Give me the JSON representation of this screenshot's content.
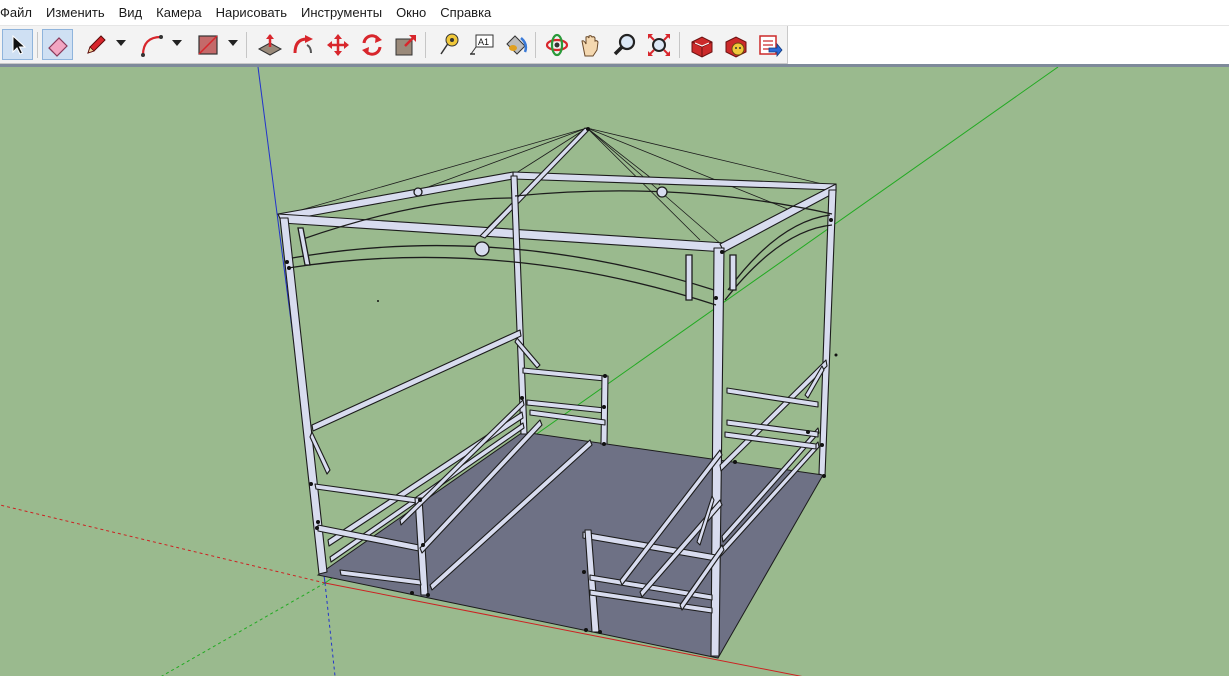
{
  "menu": [
    "Файл",
    "Изменить",
    "Вид",
    "Камера",
    "Нарисовать",
    "Инструменты",
    "Окно",
    "Справка"
  ],
  "toolbar": {
    "tools": [
      {
        "name": "select-tool",
        "icon": "arrow-cursor-icon",
        "active": true
      },
      {
        "name": "eraser-tool",
        "icon": "eraser-icon",
        "active": true
      },
      {
        "name": "pencil-tool",
        "icon": "pencil-icon"
      },
      {
        "name": "arc-tool",
        "icon": "arc-icon"
      },
      {
        "name": "rectangle-tool",
        "icon": "rectangle-icon"
      },
      {
        "name": "push-pull-tool",
        "icon": "push-pull-icon"
      },
      {
        "name": "follow-me-tool",
        "icon": "follow-me-icon"
      },
      {
        "name": "move-tool",
        "icon": "move-icon"
      },
      {
        "name": "rotate-tool",
        "icon": "rotate-icon"
      },
      {
        "name": "scale-tool",
        "icon": "scale-icon"
      },
      {
        "name": "tape-measure-tool",
        "icon": "tape-measure-icon"
      },
      {
        "name": "text-tool",
        "icon": "text-label-icon",
        "label": "A1"
      },
      {
        "name": "paint-bucket-tool",
        "icon": "paint-bucket-icon"
      },
      {
        "name": "orbit-tool",
        "icon": "orbit-icon"
      },
      {
        "name": "pan-tool",
        "icon": "hand-icon"
      },
      {
        "name": "zoom-tool",
        "icon": "magnifier-icon"
      },
      {
        "name": "zoom-extents-tool",
        "icon": "zoom-extents-icon"
      },
      {
        "name": "3d-warehouse",
        "icon": "warehouse-icon"
      },
      {
        "name": "extension-warehouse",
        "icon": "extension-warehouse-icon"
      },
      {
        "name": "share-model",
        "icon": "share-model-icon"
      }
    ]
  },
  "colors": {
    "ground": "#9aba8e",
    "floor": "#6e7185",
    "frame_fill": "#d8dcef",
    "frame_edge": "#1c1c1c",
    "axis_red": "#cc2222",
    "axis_green": "#22aa22",
    "axis_blue": "#2233cc"
  }
}
